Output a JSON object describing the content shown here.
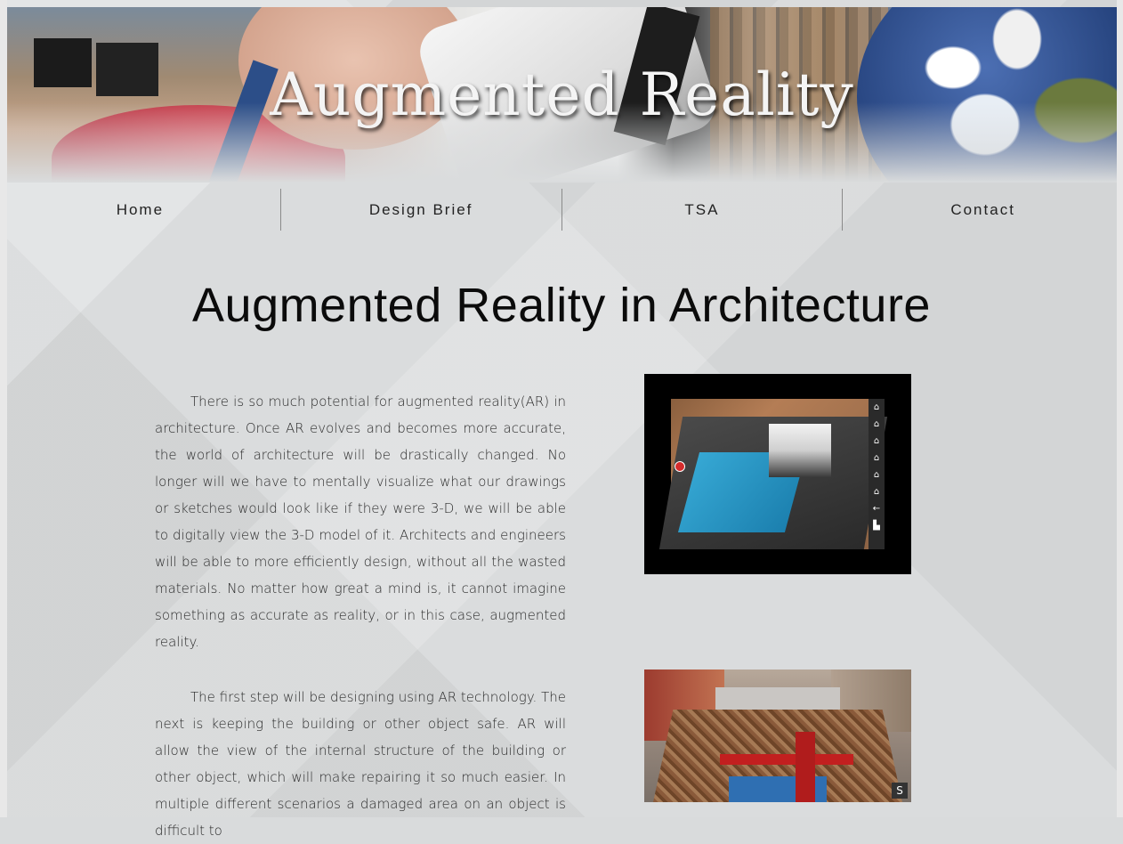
{
  "banner": {
    "title": "Augmented Reality"
  },
  "nav": {
    "items": [
      {
        "label": "Home"
      },
      {
        "label": "Design Brief"
      },
      {
        "label": "TSA"
      },
      {
        "label": "Contact"
      }
    ]
  },
  "main": {
    "title": "Augmented Reality in Architecture",
    "paragraphs": [
      "There is so much potential for augmented reality(AR) in architecture. Once AR evolves and becomes more accurate, the world of architecture will be drastically changed. No longer will we have to mentally visualize what our drawings or sketches would look like if they were 3-D, we will be able to digitally view the 3-D model of it. Architects and engineers will be able to more efficiently design, without all the wasted materials. No matter how great a mind is, it cannot imagine something as accurate as reality, or in this case, augmented reality.",
      "The first step will be designing using AR technology. The next is keeping the building or other object safe. AR will allow the view of the internal structure of the building or other object, which will make repairing it so much easier. In multiple different scenarios a damaged area on an object is difficult to"
    ]
  },
  "images": {
    "ar_model_icons": [
      "home-icon",
      "home-icon",
      "home-icon",
      "home-icon",
      "home-icon",
      "home-icon",
      "back-arrow-icon",
      "chart-icon"
    ]
  }
}
